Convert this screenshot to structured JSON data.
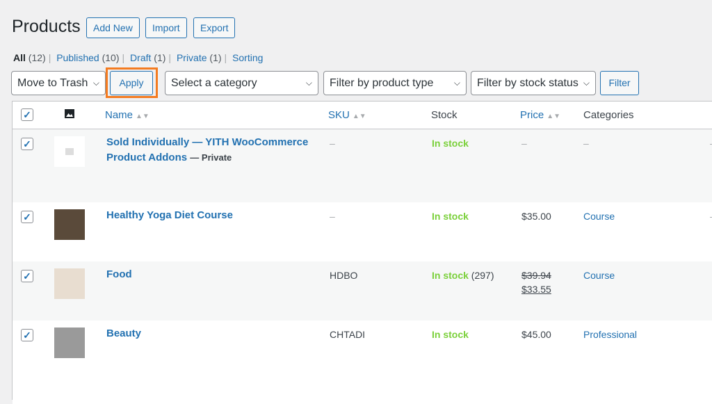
{
  "page": {
    "title": "Products",
    "buttons": [
      "Add New",
      "Import",
      "Export"
    ]
  },
  "views": [
    {
      "label": "All",
      "count": "(12)",
      "current": true
    },
    {
      "label": "Published",
      "count": "(10)"
    },
    {
      "label": "Draft",
      "count": "(1)"
    },
    {
      "label": "Private",
      "count": "(1)"
    },
    {
      "label": "Sorting",
      "count": ""
    }
  ],
  "toolbar": {
    "bulk_action": "Move to Trash",
    "apply": "Apply",
    "category": "Select a category",
    "product_type": "Filter by product type",
    "stock_status": "Filter by stock status",
    "filter": "Filter"
  },
  "columns": {
    "name": "Name",
    "sku": "SKU",
    "stock": "Stock",
    "price": "Price",
    "categories": "Categories"
  },
  "rows": [
    {
      "name": "Sold Individually — YITH WooCommerce Product Addons",
      "status": "— Private",
      "sku": "–",
      "stock": "In stock",
      "stock_count": "",
      "price": "–",
      "sale_price": "",
      "category": "–",
      "tags": "–",
      "thumb": "placeholder"
    },
    {
      "name": "Healthy Yoga Diet Course",
      "status": "",
      "sku": "–",
      "stock": "In stock",
      "stock_count": "",
      "price": "$35.00",
      "sale_price": "",
      "category": "Course",
      "tags": "–",
      "thumb": "#5a4a3a"
    },
    {
      "name": "Food",
      "status": "",
      "sku": "HDBO",
      "stock": "In stock",
      "stock_count": "(297)",
      "price": "$39.94",
      "sale_price": "$33.55",
      "category": "Course",
      "tags": "",
      "thumb": "#e8ddd0"
    },
    {
      "name": "Beauty",
      "status": "",
      "sku": "CHTADI",
      "stock": "In stock",
      "stock_count": "",
      "price": "$45.00",
      "sale_price": "",
      "category": "Professional",
      "tags": "",
      "thumb": "#9a9a9a"
    }
  ]
}
